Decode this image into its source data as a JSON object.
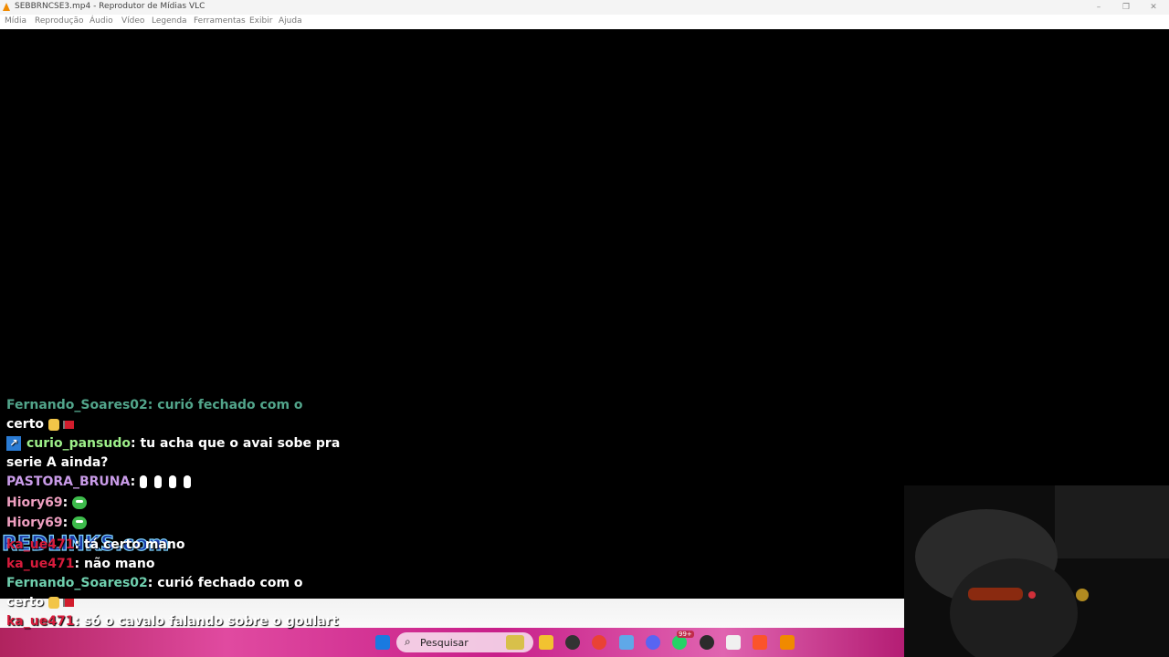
{
  "window": {
    "title": "SEBBRNCSE3.mp4 - Reprodutor de Mídias VLC",
    "controls": [
      "–",
      "❐",
      "✕"
    ]
  },
  "menu": {
    "items": [
      "Mídia",
      "Reprodução",
      "Áudio",
      "Vídeo",
      "Legenda",
      "Ferramentas",
      "Exibir",
      "Ajuda"
    ]
  },
  "chat": {
    "lines": [
      {
        "user": "Fernando_Soares02",
        "sep": ": ",
        "text": "curió fechado com o"
      },
      {
        "user": "",
        "sep": "",
        "text": "certo"
      },
      {
        "user": "curio_pansudo",
        "sep": ": ",
        "text": "tu acha que o avai sobe pra"
      },
      {
        "user": "",
        "sep": "",
        "text": "serie A ainda?"
      },
      {
        "user": "PASTORA_BRUNA",
        "sep": ": ",
        "text": ""
      },
      {
        "user": "Hiory69",
        "sep": ": ",
        "text": ""
      },
      {
        "user": "Hiory69",
        "sep": ": ",
        "text": ""
      },
      {
        "user": "ka_ue471",
        "sep": ": ",
        "text": "tá certo mano"
      },
      {
        "user": "ka_ue471",
        "sep": ": ",
        "text": "não mano"
      },
      {
        "user": "Fernando_Soares02",
        "sep": ": ",
        "text": "curió fechado com o"
      },
      {
        "user": "",
        "sep": "",
        "text": "certo"
      },
      {
        "user": "ka_ue471",
        "sep": ": ",
        "text": "só o cavalo falando sobre o goulart"
      }
    ]
  },
  "overlay": {
    "logo_text": "REDLINKS.com"
  },
  "taskbar": {
    "search_label": "Pesquisar",
    "search_icon": "search-icon",
    "notification_count": "99+",
    "icons": [
      "windows-start-icon",
      "folder-icon",
      "obs-icon",
      "chrome-icon",
      "notepad-icon",
      "discord-icon",
      "whatsapp-icon",
      "media-player-icon",
      "store-icon",
      "brave-icon",
      "vlc-icon"
    ]
  },
  "colors": {
    "user_green": "#52a58b",
    "user_lime": "#9ef08a",
    "user_purple": "#c99be8",
    "user_pink": "#ee9fc0",
    "user_red": "#d81c3c",
    "user_teal": "#6fcfae"
  }
}
